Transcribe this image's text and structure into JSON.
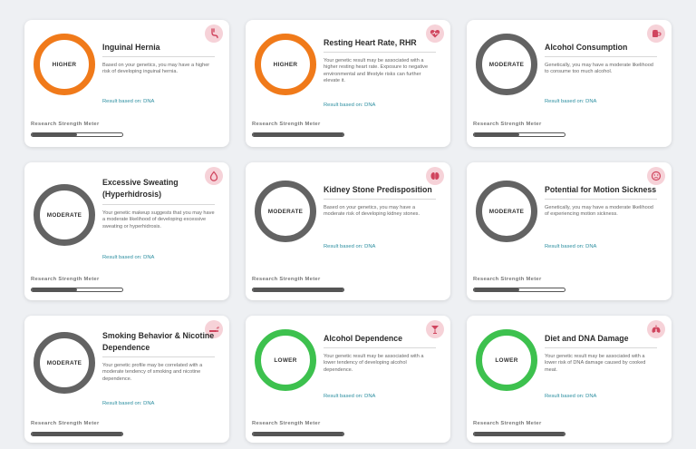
{
  "cards": [
    {
      "title": "Inguinal Hernia",
      "level": "HIGHER",
      "description": "Based on your genetics, you may have a higher risk of developing inguinal hernia.",
      "result_label": "Result based on:",
      "result_source": "DNA",
      "meter_label": "Research Strength Meter",
      "meter_fraction": 0.5,
      "icon": "stomach-icon"
    },
    {
      "title": "Resting Heart Rate, RHR",
      "level": "HIGHER",
      "description": "Your genetic result may be associated with a higher resting heart rate. Exposure to negative environmental and lifestyle risks can further elevate it.",
      "result_label": "Result based on:",
      "result_source": "DNA",
      "meter_label": "Research Strength Meter",
      "meter_fraction": 1.0,
      "icon": "heart-icon"
    },
    {
      "title": "Alcohol Consumption",
      "level": "MODERATE",
      "description": "Genetically, you may have a moderate likelihood to consume too much alcohol.",
      "result_label": "Result based on:",
      "result_source": "DNA",
      "meter_label": "Research Strength Meter",
      "meter_fraction": 0.5,
      "icon": "mug-icon"
    },
    {
      "title": "Excessive Sweating (Hyperhidrosis)",
      "level": "MODERATE",
      "description": "Your genetic makeup suggests that you may have a moderate likelihood of developing excessive sweating or hyperhidrosis.",
      "result_label": "Result based on:",
      "result_source": "DNA",
      "meter_label": "Research Strength Meter",
      "meter_fraction": 0.5,
      "icon": "drop-icon"
    },
    {
      "title": "Kidney Stone Predisposition",
      "level": "MODERATE",
      "description": "Based on your genetics, you may have a moderate risk of developing kidney stones.",
      "result_label": "Result based on:",
      "result_source": "DNA",
      "meter_label": "Research Strength Meter",
      "meter_fraction": 1.0,
      "icon": "kidney-icon"
    },
    {
      "title": "Potential for Motion Sickness",
      "level": "MODERATE",
      "description": "Genetically, you may have a moderate likelihood of experiencing motion sickness.",
      "result_label": "Result based on:",
      "result_source": "DNA",
      "meter_label": "Research Strength Meter",
      "meter_fraction": 0.5,
      "icon": "sick-face-icon"
    },
    {
      "title": "Smoking Behavior & Nicotine Dependence",
      "level": "MODERATE",
      "description": "Your genetic profile may be correlated with a moderate tendency of smoking and nicotine dependence.",
      "result_label": "Result based on:",
      "result_source": "DNA",
      "meter_label": "Research Strength Meter",
      "meter_fraction": 1.0,
      "icon": "cigarette-icon"
    },
    {
      "title": "Alcohol Dependence",
      "level": "LOWER",
      "description": "Your genetic result may be associated with a lower tendency of developing alcohol dependence.",
      "result_label": "Result based on:",
      "result_source": "DNA",
      "meter_label": "Research Strength Meter",
      "meter_fraction": 1.0,
      "icon": "cocktail-icon"
    },
    {
      "title": "Diet and DNA Damage",
      "level": "LOWER",
      "description": "Your genetic result may be associated with a lower risk of DNA damage caused by cooked meat.",
      "result_label": "Result based on:",
      "result_source": "DNA",
      "meter_label": "Research Strength Meter",
      "meter_fraction": 1.0,
      "icon": "lungs-icon"
    }
  ],
  "colors": {
    "higher": "#f07a1a",
    "moderate": "#636363",
    "lower": "#3dc14e",
    "accent": "#2b8ea0",
    "icon_bg": "#f6d2d8",
    "icon_fg": "#d0455e"
  }
}
